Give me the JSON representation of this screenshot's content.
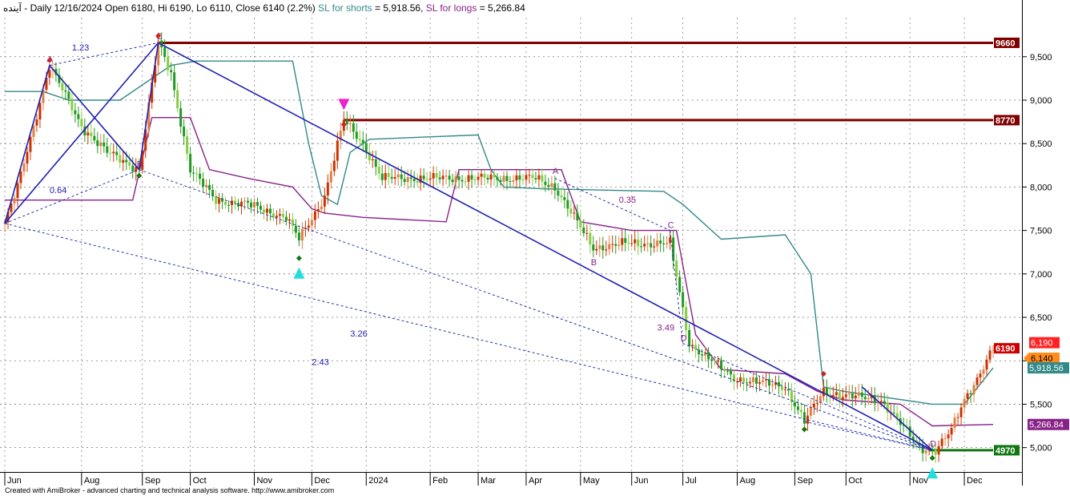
{
  "header": {
    "ticker": "آينده",
    "sep": " - ",
    "period": "Daily",
    "date": "12/16/2024",
    "open_label": "Open",
    "open": "6180",
    "hi_label": "Hi",
    "hi": "6190",
    "lo_label": "Lo",
    "lo": "6110",
    "close_label": "Close",
    "close": "6140",
    "change": "(2.2%)",
    "sl_shorts_label": "SL for shorts",
    "sl_shorts_value": "= 5,918.56,",
    "sl_longs_label": "SL for longs",
    "sl_longs_value": "= 5,266.84"
  },
  "footer": {
    "credit": "Created with AmiBroker - advanced charting and technical analysis software. http://www.amibroker.com"
  },
  "colors": {
    "up": "#cc3300",
    "up_light": "#e08040",
    "down": "#229922",
    "down_light": "#88cc44",
    "sl_shorts": "#338888",
    "sl_longs": "#882288",
    "trend": "#1f1fb3",
    "dotted": "#2233aa",
    "level_top": "#800000",
    "level_bottom": "#117711",
    "cyan": "#22dddd",
    "magenta": "#ee22cc"
  },
  "chart_data": {
    "type": "candlestick",
    "title": "Daily 12/16/2024",
    "xlabel": "",
    "ylabel": "",
    "ylim": [
      4720,
      9950
    ],
    "y_ticks": [
      5000,
      5500,
      6000,
      6500,
      7000,
      7500,
      8000,
      8500,
      9000,
      9500
    ],
    "y_tick_labels": [
      "5,000",
      "5,500",
      "6,000",
      "6,500",
      "7,000",
      "7,500",
      "8,000",
      "8,500",
      "9,000",
      "9,500"
    ],
    "x_labels": [
      "Jun",
      "Aug",
      "Sep",
      "Oct",
      "Nov",
      "Dec",
      "2024",
      "Feb",
      "Mar",
      "Apr",
      "May",
      "Jun",
      "Jul",
      "Aug",
      "Sep",
      "Oct",
      "Nov",
      "Dec"
    ],
    "x_label_index": [
      0,
      24,
      43,
      58,
      78,
      96,
      113,
      133,
      148,
      163,
      180,
      196,
      212,
      229,
      247,
      263,
      283,
      300
    ],
    "n_bars": 310,
    "price_path": [
      [
        0,
        7580
      ],
      [
        4,
        8000
      ],
      [
        14,
        9400
      ],
      [
        24,
        8700
      ],
      [
        32,
        8400
      ],
      [
        42,
        8200
      ],
      [
        48,
        9660
      ],
      [
        52,
        9300
      ],
      [
        58,
        8200
      ],
      [
        66,
        7850
      ],
      [
        76,
        7800
      ],
      [
        88,
        7650
      ],
      [
        92,
        7400
      ],
      [
        97,
        7700
      ],
      [
        100,
        7900
      ],
      [
        106,
        8770
      ],
      [
        112,
        8500
      ],
      [
        118,
        8100
      ],
      [
        156,
        8100
      ],
      [
        166,
        8100
      ],
      [
        172,
        8000
      ],
      [
        184,
        7300
      ],
      [
        194,
        7350
      ],
      [
        208,
        7350
      ],
      [
        214,
        6200
      ],
      [
        228,
        5800
      ],
      [
        244,
        5700
      ],
      [
        250,
        5300
      ],
      [
        256,
        5650
      ],
      [
        262,
        5600
      ],
      [
        274,
        5550
      ],
      [
        286,
        5000
      ],
      [
        291,
        4970
      ],
      [
        296,
        5200
      ],
      [
        300,
        5550
      ],
      [
        304,
        5800
      ],
      [
        309,
        6140
      ]
    ],
    "sl_shorts_line": [
      [
        0,
        9100
      ],
      [
        12,
        9100
      ],
      [
        20,
        9000
      ],
      [
        36,
        9000
      ],
      [
        52,
        9400
      ],
      [
        60,
        9450
      ],
      [
        90,
        9450
      ],
      [
        95,
        8500
      ],
      [
        99,
        7900
      ],
      [
        104,
        7800
      ],
      [
        108,
        8400
      ],
      [
        114,
        8550
      ],
      [
        148,
        8600
      ],
      [
        152,
        8200
      ],
      [
        156,
        8000
      ],
      [
        168,
        7980
      ],
      [
        206,
        7950
      ],
      [
        212,
        7800
      ],
      [
        224,
        7400
      ],
      [
        244,
        7450
      ],
      [
        252,
        7000
      ],
      [
        256,
        5700
      ],
      [
        262,
        5650
      ],
      [
        290,
        5500
      ],
      [
        300,
        5500
      ],
      [
        309,
        5918.56
      ]
    ],
    "sl_longs_line": [
      [
        0,
        7850
      ],
      [
        40,
        7850
      ],
      [
        46,
        8800
      ],
      [
        58,
        8800
      ],
      [
        64,
        8200
      ],
      [
        76,
        8100
      ],
      [
        90,
        8000
      ],
      [
        96,
        7750
      ],
      [
        100,
        7700
      ],
      [
        112,
        7650
      ],
      [
        138,
        7600
      ],
      [
        142,
        8200
      ],
      [
        174,
        8200
      ],
      [
        180,
        7600
      ],
      [
        196,
        7500
      ],
      [
        210,
        7500
      ],
      [
        216,
        6300
      ],
      [
        224,
        5900
      ],
      [
        244,
        5850
      ],
      [
        254,
        5650
      ],
      [
        262,
        5550
      ],
      [
        280,
        5500
      ],
      [
        290,
        5250
      ],
      [
        309,
        5266.84
      ]
    ],
    "trend_lines": [
      [
        [
          0,
          7580
        ],
        [
          14,
          9400
        ]
      ],
      [
        [
          14,
          9400
        ],
        [
          42,
          8200
        ]
      ],
      [
        [
          42,
          8200
        ],
        [
          48,
          9660
        ]
      ],
      [
        [
          48,
          9660
        ],
        [
          290,
          4970
        ]
      ],
      [
        [
          0,
          7580
        ],
        [
          48,
          9660
        ]
      ],
      [
        [
          268,
          5700
        ],
        [
          290,
          4970
        ]
      ]
    ],
    "dotted_lines": [
      [
        [
          0,
          7580
        ],
        [
          290,
          4970
        ]
      ],
      [
        [
          14,
          9400
        ],
        [
          48,
          9660
        ]
      ],
      [
        [
          0,
          7580
        ],
        [
          42,
          8200
        ]
      ],
      [
        [
          42,
          8200
        ],
        [
          290,
          4970
        ]
      ],
      [
        [
          172,
          8100
        ],
        [
          208,
          7500
        ]
      ],
      [
        [
          208,
          7500
        ],
        [
          212,
          6200
        ]
      ],
      [
        [
          212,
          6200
        ],
        [
          290,
          4970
        ]
      ],
      [
        [
          250,
          5300
        ],
        [
          290,
          4970
        ]
      ]
    ],
    "horizontal_levels": [
      {
        "label": "9660",
        "value": 9660,
        "from": 48,
        "color": "#800000"
      },
      {
        "label": "8770",
        "value": 8770,
        "from": 106,
        "color": "#800000"
      },
      {
        "label": "4970",
        "value": 4970,
        "from": 289,
        "color": "#117711"
      }
    ],
    "right_tags": [
      {
        "label": "6,190",
        "value": 6190,
        "color": "#ff2222",
        "text": "light"
      },
      {
        "label": "6190",
        "value": 6190,
        "color": "#cc0000",
        "text": "light",
        "boxed": true
      },
      {
        "label": "6,140",
        "value": 6140,
        "color": "#ff8c1a",
        "text": "dark"
      },
      {
        "label": "5,918.56",
        "value": 5918.56,
        "color": "#338888",
        "text": "light"
      },
      {
        "label": "5,266.84",
        "value": 5266.84,
        "color": "#882288",
        "text": "light"
      }
    ],
    "ratio_labels": [
      {
        "text": "1.23",
        "x": 21,
        "y": 9570,
        "color": "#1f1fb3"
      },
      {
        "text": "0.64",
        "x": 14,
        "y": 7930,
        "color": "#1f1fb3"
      },
      {
        "text": "3.26",
        "x": 108,
        "y": 6280,
        "color": "#1f1fb3"
      },
      {
        "text": "2.43",
        "x": 96,
        "y": 5950,
        "color": "#1f1fb3"
      },
      {
        "text": "0.35",
        "x": 192,
        "y": 7820,
        "color": "#882288"
      },
      {
        "text": "3.49",
        "x": 204,
        "y": 6350,
        "color": "#882288"
      }
    ],
    "point_labels": [
      {
        "text": "A",
        "x": 14,
        "y": 9440
      },
      {
        "text": "B",
        "x": 42,
        "y": 8230
      },
      {
        "text": "C",
        "x": 48,
        "y": 9700
      },
      {
        "text": "A",
        "x": 172,
        "y": 8150
      },
      {
        "text": "B",
        "x": 184,
        "y": 7100
      },
      {
        "text": "C",
        "x": 208,
        "y": 7530
      },
      {
        "text": "D",
        "x": 212,
        "y": 6230
      },
      {
        "text": "D",
        "x": 290,
        "y": 5010
      }
    ],
    "markers": [
      {
        "kind": "up_triangle",
        "x": 92,
        "y": 7010,
        "color": "#22dddd"
      },
      {
        "kind": "up_triangle",
        "x": 290,
        "y": 4710,
        "color": "#22dddd"
      },
      {
        "kind": "down_triangle",
        "x": 106,
        "y": 8950,
        "color": "#ee22cc"
      },
      {
        "kind": "diamond",
        "x": 14,
        "y": 9460,
        "color": "#cc2222"
      },
      {
        "kind": "diamond",
        "x": 48,
        "y": 9740,
        "color": "#cc2222"
      },
      {
        "kind": "diamond",
        "x": 106,
        "y": 8720,
        "color": "#cc2222"
      },
      {
        "kind": "diamond",
        "x": 256,
        "y": 5850,
        "color": "#cc2222"
      },
      {
        "kind": "diamond",
        "x": 42,
        "y": 8130,
        "color": "#117711"
      },
      {
        "kind": "diamond",
        "x": 92,
        "y": 7180,
        "color": "#117711"
      },
      {
        "kind": "diamond",
        "x": 250,
        "y": 5210,
        "color": "#117711"
      },
      {
        "kind": "diamond",
        "x": 290,
        "y": 4880,
        "color": "#117711"
      }
    ]
  }
}
